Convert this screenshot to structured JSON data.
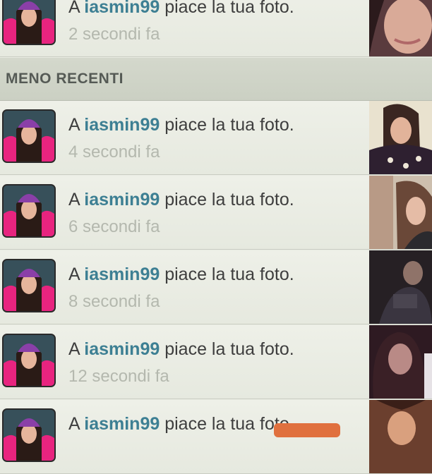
{
  "section": {
    "title": "MENO RECENTI"
  },
  "notifications": [
    {
      "prefix": "A",
      "username": "iasmin99",
      "action": "piace la tua foto.",
      "time": "2 secondi fa"
    },
    {
      "prefix": "A",
      "username": "iasmin99",
      "action": "piace la tua foto.",
      "time": "4 secondi fa"
    },
    {
      "prefix": "A",
      "username": "iasmin99",
      "action": "piace la tua foto.",
      "time": "6 secondi fa"
    },
    {
      "prefix": "A",
      "username": "iasmin99",
      "action": "piace la tua foto.",
      "time": "8 secondi fa"
    },
    {
      "prefix": "A",
      "username": "iasmin99",
      "action": "piace la tua foto.",
      "time": "12 secondi fa"
    },
    {
      "prefix": "A",
      "username": "iasmin99",
      "action": "piace la tua foto.",
      "time": ""
    }
  ],
  "colors": {
    "username": "#3d7f93",
    "text": "#3e3e3e",
    "timestamp": "#b4b8ae",
    "avatar_hood": "#e8247f",
    "avatar_hat": "#8a3fa8"
  }
}
